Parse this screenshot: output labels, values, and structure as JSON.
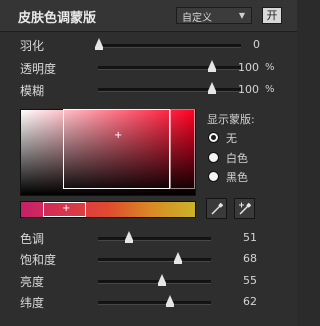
{
  "panel": {
    "title": "皮肤色调蒙版",
    "preset": {
      "value": "自定义",
      "caret": "▼"
    },
    "open_button": "开"
  },
  "top_sliders": [
    {
      "label": "羽化",
      "value": "0",
      "unit": "",
      "fraction": 0.0
    },
    {
      "label": "透明度",
      "value": "100",
      "unit": "%",
      "fraction": 1.0
    },
    {
      "label": "模糊",
      "value": "100",
      "unit": "%",
      "fraction": 1.0
    }
  ],
  "mask_display": {
    "title": "显示蒙版:",
    "options": [
      {
        "label": "无",
        "selected": true
      },
      {
        "label": "白色",
        "selected": false
      },
      {
        "label": "黑色",
        "selected": false
      }
    ]
  },
  "color_field_crosshair": "+",
  "hue_bar_crosshair": "+",
  "bottom_sliders": [
    {
      "label": "色调",
      "value": "51",
      "fraction": 0.25
    },
    {
      "label": "饱和度",
      "value": "68",
      "fraction": 0.68
    },
    {
      "label": "亮度",
      "value": "55",
      "fraction": 0.55
    },
    {
      "label": "纬度",
      "value": "62",
      "fraction": 0.62
    }
  ],
  "tools": [
    {
      "icon": "eyedropper-icon"
    },
    {
      "icon": "eyedropper-plus-icon"
    }
  ]
}
